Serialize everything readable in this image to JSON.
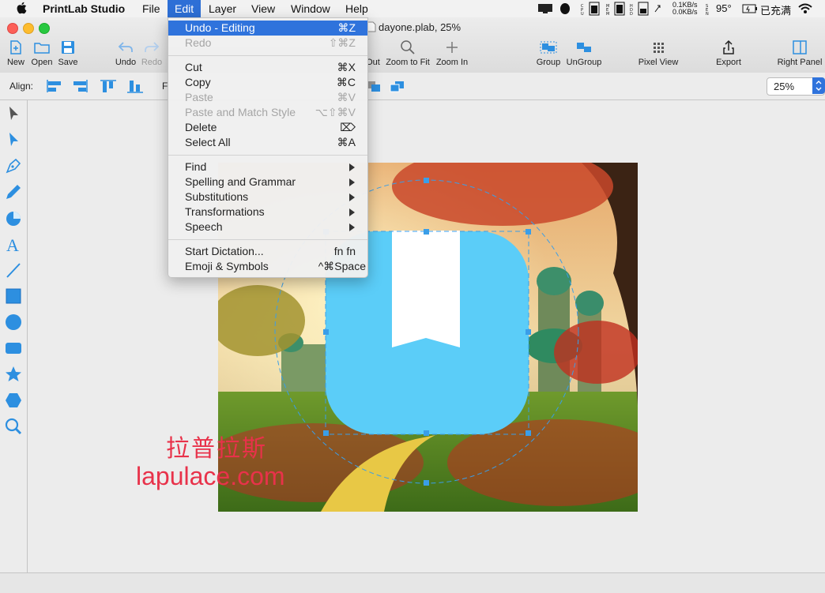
{
  "menubar": {
    "app_name": "PrintLab Studio",
    "items": [
      "File",
      "Edit",
      "Layer",
      "View",
      "Window",
      "Help"
    ],
    "status": {
      "net_up": "0.1KB/s",
      "net_down": "0.0KB/s",
      "temperature": "95°",
      "battery": "已充满"
    }
  },
  "window": {
    "title": "dayone.plab, 25%"
  },
  "toolbar": {
    "new": "New",
    "open": "Open",
    "save": "Save",
    "undo": "Undo",
    "redo": "Redo",
    "out_partial": "Out",
    "zoom_to_fit": "Zoom to Fit",
    "zoom_in": "Zoom In",
    "group": "Group",
    "ungroup": "UnGroup",
    "pixel_view": "Pixel View",
    "export": "Export",
    "right_panel": "Right Panel"
  },
  "alignbar": {
    "label": "Align:",
    "partial": "F",
    "zoom_value": "25%"
  },
  "edit_menu": {
    "undo": {
      "label": "Undo - Editing",
      "shortcut": "⌘Z"
    },
    "redo": {
      "label": "Redo",
      "shortcut": "⇧⌘Z"
    },
    "cut": {
      "label": "Cut",
      "shortcut": "⌘X"
    },
    "copy": {
      "label": "Copy",
      "shortcut": "⌘C"
    },
    "paste": {
      "label": "Paste",
      "shortcut": "⌘V"
    },
    "paste_match": {
      "label": "Paste and Match Style",
      "shortcut": "⌥⇧⌘V"
    },
    "delete": {
      "label": "Delete",
      "shortcut": "⌦"
    },
    "select_all": {
      "label": "Select All",
      "shortcut": "⌘A"
    },
    "find": {
      "label": "Find"
    },
    "spelling": {
      "label": "Spelling and Grammar"
    },
    "substitutions": {
      "label": "Substitutions"
    },
    "transformations": {
      "label": "Transformations"
    },
    "speech": {
      "label": "Speech"
    },
    "dictation": {
      "label": "Start Dictation...",
      "shortcut": "fn fn"
    },
    "emoji": {
      "label": "Emoji & Symbols",
      "shortcut": "^⌘Space"
    }
  },
  "canvas": {
    "watermark_cn": "拉普拉斯",
    "watermark_en": "lapulace.com"
  },
  "colors": {
    "accent": "#2f73dc",
    "shape_fill": "#5bcdf8",
    "selection": "#3a9ee8",
    "watermark": "#e8324a"
  }
}
